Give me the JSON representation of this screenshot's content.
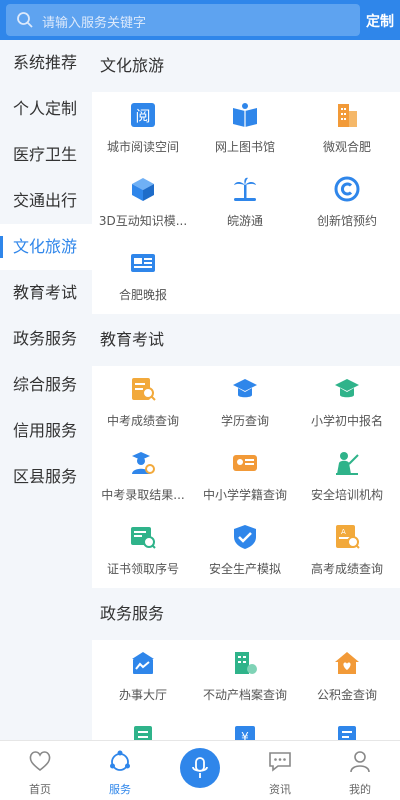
{
  "search": {
    "placeholder": "请输入服务关键字",
    "custom_label": "定制"
  },
  "sidebar": {
    "items": [
      {
        "label": "系统推荐",
        "active": false
      },
      {
        "label": "个人定制",
        "active": false
      },
      {
        "label": "医疗卫生",
        "active": false
      },
      {
        "label": "交通出行",
        "active": false
      },
      {
        "label": "文化旅游",
        "active": true
      },
      {
        "label": "教育考试",
        "active": false
      },
      {
        "label": "政务服务",
        "active": false
      },
      {
        "label": "综合服务",
        "active": false
      },
      {
        "label": "信用服务",
        "active": false
      },
      {
        "label": "区县服务",
        "active": false
      }
    ]
  },
  "sections": [
    {
      "title": "文化旅游",
      "items": [
        {
          "label": "城市阅读空间",
          "icon": "book-read-icon",
          "color": "#2f86ea"
        },
        {
          "label": "网上图书馆",
          "icon": "open-book-icon",
          "color": "#2f86ea"
        },
        {
          "label": "微观合肥",
          "icon": "building-icon",
          "color": "#f29a38"
        },
        {
          "label": "3D互动知识模...",
          "icon": "cube-icon",
          "color": "#2f86ea"
        },
        {
          "label": "皖游通",
          "icon": "palm-tree-icon",
          "color": "#2f86ea"
        },
        {
          "label": "创新馆预约",
          "icon": "c-circle-icon",
          "color": "#2f86ea"
        },
        {
          "label": "合肥晚报",
          "icon": "newspaper-icon",
          "color": "#2f86ea"
        }
      ]
    },
    {
      "title": "教育考试",
      "items": [
        {
          "label": "中考成绩查询",
          "icon": "score-search-icon",
          "color": "#f2a93b"
        },
        {
          "label": "学历查询",
          "icon": "grad-cap-icon",
          "color": "#2f86ea"
        },
        {
          "label": "小学初中报名",
          "icon": "grad-cap-green-icon",
          "color": "#2fb38a"
        },
        {
          "label": "中考录取结果...",
          "icon": "student-icon",
          "color": "#2f86ea"
        },
        {
          "label": "中小学学籍查询",
          "icon": "id-card-icon",
          "color": "#f29a38"
        },
        {
          "label": "安全培训机构",
          "icon": "teacher-icon",
          "color": "#2fb38a"
        },
        {
          "label": "证书领取序号",
          "icon": "certificate-icon",
          "color": "#2fb38a"
        },
        {
          "label": "安全生产模拟",
          "icon": "shield-check-icon",
          "color": "#2f86ea"
        },
        {
          "label": "高考成绩查询",
          "icon": "doc-search-icon",
          "color": "#f2a93b"
        }
      ]
    },
    {
      "title": "政务服务",
      "items": [
        {
          "label": "办事大厅",
          "icon": "hall-icon",
          "color": "#2f86ea"
        },
        {
          "label": "不动产档案查询",
          "icon": "property-icon",
          "color": "#2fb38a"
        },
        {
          "label": "公积金查询",
          "icon": "house-heart-icon",
          "color": "#f29a38"
        },
        {
          "label": "",
          "icon": "green-doc-icon",
          "color": "#2fb38a"
        },
        {
          "label": "",
          "icon": "yuan-icon",
          "color": "#2f86ea"
        },
        {
          "label": "",
          "icon": "blue-doc-icon",
          "color": "#2f86ea"
        }
      ]
    }
  ],
  "tabbar": [
    {
      "label": "首页",
      "icon": "heart-icon",
      "active": false
    },
    {
      "label": "服务",
      "icon": "service-icon",
      "active": true
    },
    {
      "label": "",
      "icon": "mic-icon",
      "active": false
    },
    {
      "label": "资讯",
      "icon": "chat-icon",
      "active": false
    },
    {
      "label": "我的",
      "icon": "user-icon",
      "active": false
    }
  ],
  "colors": {
    "primary": "#2f86ea",
    "green": "#2fb38a",
    "orange": "#f29a38"
  }
}
